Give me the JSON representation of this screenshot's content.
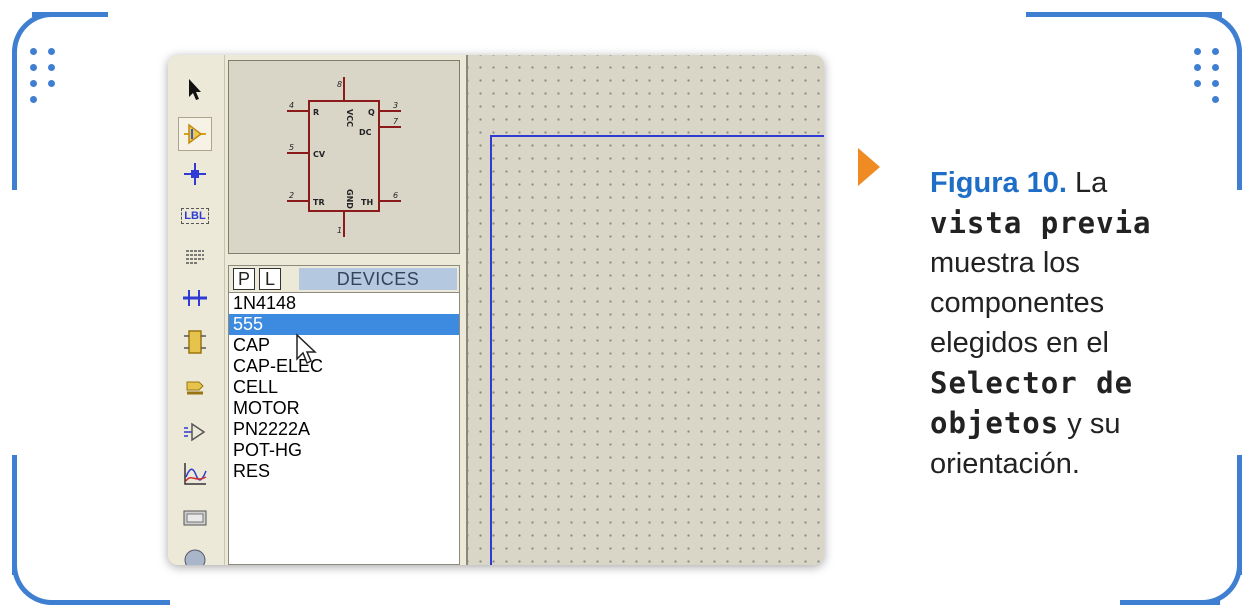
{
  "colors": {
    "frame": "#3f7fd1",
    "accent_arrow": "#f08a23",
    "figure_label": "#1e6ec8",
    "selection": "#3d8be0",
    "sheet_border": "#2f3bd3"
  },
  "toolbar": {
    "tools": [
      {
        "icon": "selection-arrow-icon"
      },
      {
        "icon": "component-mode-icon",
        "selected": true
      },
      {
        "icon": "junction-dot-icon"
      },
      {
        "icon": "wire-label-icon",
        "text": "LBL"
      },
      {
        "icon": "text-script-icon"
      },
      {
        "icon": "buses-icon"
      },
      {
        "icon": "subcircuit-icon"
      },
      {
        "icon": "terminals-icon"
      },
      {
        "icon": "device-pins-icon"
      },
      {
        "icon": "graph-icon"
      },
      {
        "icon": "tape-recorder-icon"
      },
      {
        "icon": "generator-icon"
      }
    ]
  },
  "preview": {
    "chip_pins": {
      "r": "R",
      "vcc": "VCC",
      "q": "Q",
      "dc": "DC",
      "cv": "CV",
      "tr": "TR",
      "gnd": "GND",
      "th": "TH",
      "n4": "4",
      "n8": "8",
      "n3": "3",
      "n7": "7",
      "n5": "5",
      "n2": "2",
      "n6": "6",
      "n1": "1"
    }
  },
  "devices": {
    "p_label": "P",
    "l_label": "L",
    "title": "DEVICES",
    "items": [
      "1N4148",
      "555",
      "CAP",
      "CAP-ELEC",
      "CELL",
      "MOTOR",
      "PN2222A",
      "POT-HG",
      "RES"
    ],
    "selected_index": 1
  },
  "caption": {
    "figure": "Figura 10.",
    "l1_rest": " La",
    "l2": "vista previa",
    "l3": "muestra los",
    "l4": "componentes",
    "l5": "elegidos en el",
    "l6": "Selector de",
    "l7_mono": "objetos",
    "l7_rest": " y su",
    "l8": "orientación."
  }
}
